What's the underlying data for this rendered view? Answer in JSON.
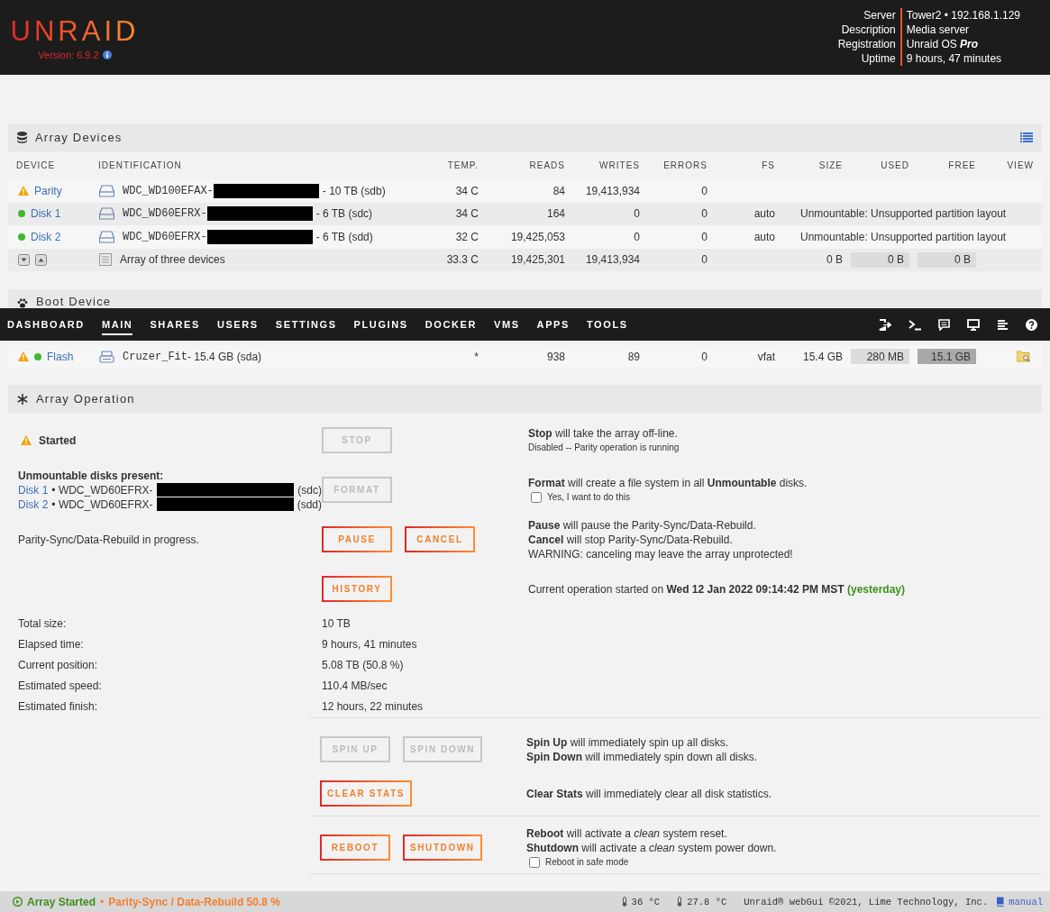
{
  "header": {
    "logo": "UNRAID",
    "version": "Version: 6.9.2",
    "info": [
      {
        "label": "Server",
        "value": "Tower2 • 192.168.1.129"
      },
      {
        "label": "Description",
        "value": "Media server"
      },
      {
        "label": "Registration",
        "value": "Unraid OS **Pro**"
      },
      {
        "label": "Uptime",
        "value": "9 hours, 47 minutes"
      }
    ]
  },
  "array_devices": {
    "title": "Array Devices",
    "columns": [
      "DEVICE",
      "IDENTIFICATION",
      "TEMP.",
      "READS",
      "WRITES",
      "ERRORS",
      "FS",
      "SIZE",
      "USED",
      "FREE",
      "VIEW"
    ],
    "rows": [
      {
        "device": "Parity",
        "warning": true,
        "online": false,
        "model": "WDC_WD100EFAX-",
        "redacted": true,
        "capacity": "- 10 TB (sdb)",
        "temp": "34 C",
        "reads": "84",
        "writes": "19,413,934",
        "errors": "0"
      },
      {
        "device": "Disk 1",
        "warning": false,
        "online": true,
        "model": "WDC_WD60EFRX-",
        "redacted": true,
        "capacity": "- 6 TB (sdc)",
        "temp": "34 C",
        "reads": "164",
        "writes": "0",
        "errors": "0",
        "fs": "auto",
        "message": "Unmountable: Unsupported partition layout"
      },
      {
        "device": "Disk 2",
        "warning": false,
        "online": true,
        "model": "WDC_WD60EFRX-",
        "redacted": true,
        "capacity": "- 6 TB (sdd)",
        "temp": "32 C",
        "reads": "19,425,053",
        "writes": "0",
        "errors": "0",
        "fs": "auto",
        "message": "Unmountable: Unsupported partition layout"
      }
    ],
    "summary": {
      "label": "Array of three devices",
      "temp": "33.3 C",
      "reads": "19,425,301",
      "writes": "19,413,934",
      "errors": "0",
      "size": "0 B",
      "used": {
        "text": "0 B"
      },
      "free": {
        "text": "0 B"
      }
    }
  },
  "boot_device": {
    "title": "Boot Device",
    "row": {
      "device": "Flash",
      "warning": true,
      "online": true,
      "model": "Cruzer_Fit",
      "capacity": "- 15.4 GB (sda)",
      "temp": "*",
      "reads": "938",
      "writes": "89",
      "errors": "0",
      "fs": "vfat",
      "size": "15.4 GB",
      "used": {
        "text": "280 MB",
        "full": false
      },
      "free": {
        "text": "15.1 GB",
        "full": true
      },
      "browsable": true
    }
  },
  "nav": [
    {
      "label": "DASHBOARD",
      "selected": false
    },
    {
      "label": "MAIN",
      "selected": true
    },
    {
      "label": "SHARES",
      "selected": false
    },
    {
      "label": "USERS",
      "selected": false
    },
    {
      "label": "SETTINGS",
      "selected": false
    },
    {
      "label": "PLUGINS",
      "selected": false
    },
    {
      "label": "DOCKER",
      "selected": false
    },
    {
      "label": "VMS",
      "selected": false
    },
    {
      "label": "APPS",
      "selected": false
    },
    {
      "label": "TOOLS",
      "selected": false
    }
  ],
  "operation": {
    "title": "Array Operation",
    "rows": [
      {
        "left": {
          "kind": "status",
          "text": "Started"
        },
        "buttons": [
          {
            "label": "STOP",
            "disabled": true
          }
        ],
        "lines": [
          {
            "kind": "text",
            "text": "**Stop** will take the array off-line."
          },
          {
            "kind": "note",
            "text": "Disabled -- Parity operation is running"
          }
        ]
      },
      {
        "left": {
          "kind": "disks",
          "heading": "Unmountable disks present:",
          "disks": [
            {
              "name": "Disk 1",
              "model": "• WDC_WD60EFRX-",
              "redacted": true,
              "dev": "(sdc)"
            },
            {
              "name": "Disk 2",
              "model": "• WDC_WD60EFRX-",
              "redacted": true,
              "dev": "(sdd)"
            }
          ]
        },
        "buttons": [
          {
            "label": "FORMAT",
            "disabled": true
          }
        ],
        "lines": [
          {
            "kind": "text",
            "text": "**Format** will create a file system in all **Unmountable** disks."
          },
          {
            "kind": "checkbox",
            "label": "Yes, I want to do this",
            "checked": false
          }
        ]
      },
      {
        "left": {
          "kind": "text",
          "text": "Parity-Sync/Data-Rebuild in progress."
        },
        "buttons": [
          {
            "label": "PAUSE",
            "disabled": false
          },
          {
            "label": "CANCEL",
            "disabled": false
          }
        ],
        "lines": [
          {
            "kind": "text",
            "text": "**Pause** will pause the Parity-Sync/Data-Rebuild."
          },
          {
            "kind": "text",
            "text": "**Cancel** will stop Parity-Sync/Data-Rebuild."
          },
          {
            "kind": "text",
            "text": "WARNING: canceling may leave the array unprotected!"
          }
        ]
      },
      {
        "buttons": [
          {
            "label": "HISTORY",
            "disabled": false
          }
        ],
        "lines": [
          {
            "kind": "text",
            "text": "Current operation started on **Wed 12 Jan 2022 09:14:42 PM MST**",
            "suffix": "(yesterday)"
          }
        ]
      }
    ],
    "stats": [
      {
        "label": "Total size:",
        "value": "10 TB"
      },
      {
        "label": "Elapsed time:",
        "value": "9 hours, 41 minutes"
      },
      {
        "label": "Current position:",
        "value": "5.08 TB (50.8 %)"
      },
      {
        "label": "Estimated speed:",
        "value": "110.4 MB/sec"
      },
      {
        "label": "Estimated finish:",
        "value": "12 hours, 22 minutes"
      }
    ],
    "actions": [
      [
        {
          "buttons": [
            {
              "label": "SPIN UP",
              "disabled": true
            },
            {
              "label": "SPIN DOWN",
              "disabled": true
            }
          ],
          "lines": [
            {
              "kind": "text",
              "text": "**Spin Up** will immediately spin up all disks."
            },
            {
              "kind": "text",
              "text": "**Spin Down** will immediately spin down all disks."
            }
          ]
        },
        {
          "buttons": [
            {
              "label": "CLEAR STATS",
              "disabled": false
            }
          ],
          "lines": [
            {
              "kind": "text",
              "text": "**Clear Stats** will immediately clear all disk statistics."
            }
          ]
        }
      ],
      [
        {
          "buttons": [
            {
              "label": "REBOOT",
              "disabled": false
            },
            {
              "label": "SHUTDOWN",
              "disabled": false
            }
          ],
          "lines": [
            {
              "kind": "text",
              "text": "**Reboot** will activate a *clean* system reset."
            },
            {
              "kind": "text",
              "text": "**Shutdown** will activate a *clean* system power down."
            },
            {
              "kind": "checkbox",
              "label": "Reboot in safe mode",
              "checked": false
            }
          ]
        }
      ]
    ]
  },
  "status_bar": {
    "state": "Array Started",
    "separator": "•",
    "operation": "Parity-Sync / Data-Rebuild 50.8 %",
    "temps": [
      "36 °C",
      "27.8 °C"
    ],
    "copyright": "Unraid® webGui ©2021, Lime Technology, Inc.",
    "link": "manual"
  }
}
